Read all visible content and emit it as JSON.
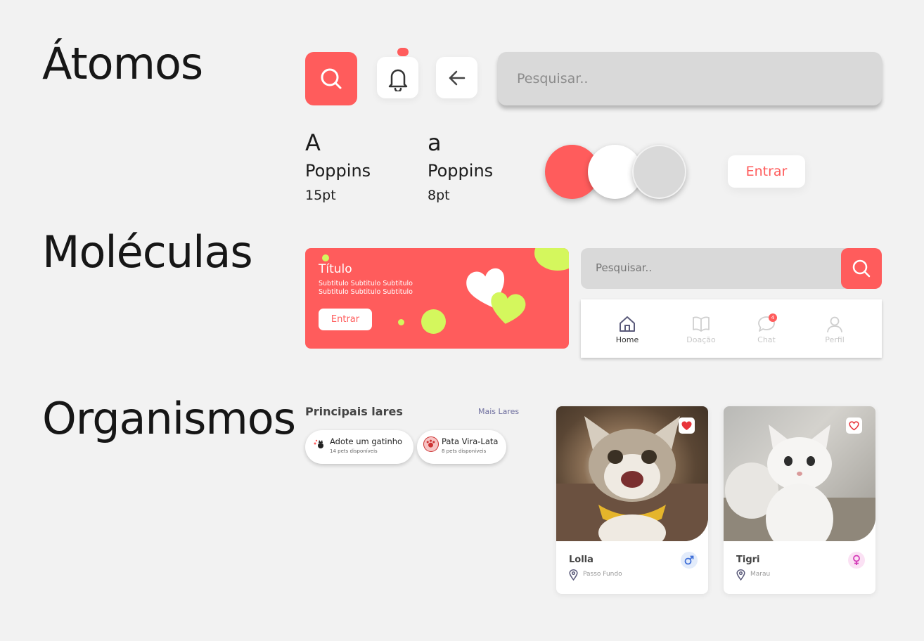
{
  "sections": {
    "atoms": "Átomos",
    "molecules": "Moléculas",
    "organisms": "Organismos"
  },
  "colors": {
    "primary": "#ff5c5c",
    "white": "#ffffff",
    "grey": "#d9d9d9",
    "accent_lime": "#d4f75d"
  },
  "atoms": {
    "icons": [
      "search-icon",
      "bell-icon",
      "arrow-left-icon"
    ],
    "search_placeholder": "Pesquisar..",
    "typography": [
      {
        "glyph": "A",
        "family": "Poppins",
        "size": "15pt"
      },
      {
        "glyph": "a",
        "family": "Poppins",
        "size": "8pt"
      }
    ],
    "enter_label": "Entrar"
  },
  "molecules": {
    "banner": {
      "title": "Título",
      "subtitle": "Subtitulo Subtitulo Subtitulo Subtitulo Subtitulo Subtitulo",
      "button": "Entrar"
    },
    "search_placeholder": "Pesquisar..",
    "nav": [
      {
        "label": "Home",
        "icon": "home-icon",
        "active": true
      },
      {
        "label": "Doação",
        "icon": "book-icon",
        "active": false
      },
      {
        "label": "Chat",
        "icon": "chat-icon",
        "active": false,
        "badge": "4"
      },
      {
        "label": "Perfil",
        "icon": "user-icon",
        "active": false
      }
    ]
  },
  "organisms": {
    "homes_title": "Principais lares",
    "homes_more": "Mais Lares",
    "homes": [
      {
        "name": "Adote um gatinho",
        "count": "14 pets disponíveis"
      },
      {
        "name": "Pata Vira-Lata",
        "count": "8 pets disponíveis"
      }
    ],
    "pets": [
      {
        "name": "Lolla",
        "location": "Passo Fundo",
        "sex": "male",
        "favorite": true
      },
      {
        "name": "Tigri",
        "location": "Marau",
        "sex": "female",
        "favorite": false
      }
    ]
  }
}
